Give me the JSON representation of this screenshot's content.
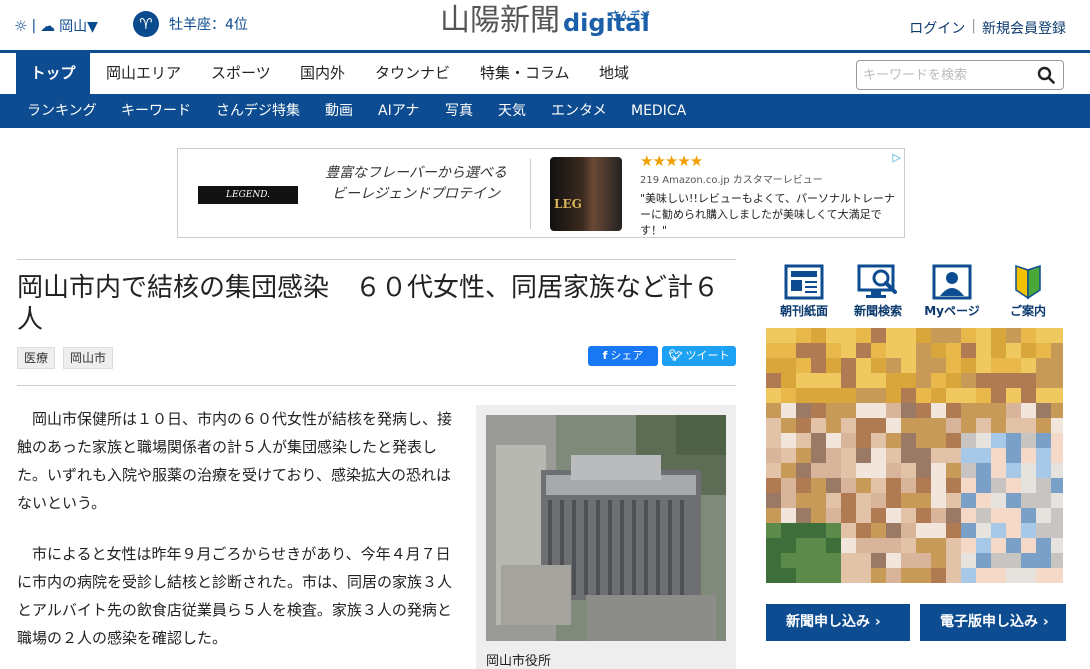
{
  "header": {
    "weather_city": "岡山▼",
    "horoscope": "牡羊座：4位",
    "logo_jp": "山陽新聞",
    "logo_digital": "digital",
    "logo_sub": "さんデジ",
    "login": "ログイン",
    "register": "新規会員登録"
  },
  "nav_main": {
    "items": [
      "トップ",
      "岡山エリア",
      "スポーツ",
      "国内外",
      "タウンナビ",
      "特集・コラム",
      "地域"
    ],
    "active_index": 0
  },
  "search": {
    "placeholder": "キーワードを検索"
  },
  "nav_sub": {
    "items": [
      "ランキング",
      "キーワード",
      "さんデジ特集",
      "動画",
      "AIアナ",
      "写真",
      "天気",
      "エンタメ",
      "MEDICA"
    ]
  },
  "ad": {
    "brand": "LEGEND.",
    "copy": "豊富なフレーバーから選べるビーレジェンドプロテイン",
    "product_label": "LEG",
    "stars": "★★★★★",
    "review_meta": "219 Amazon.co.jp カスタマーレビュー",
    "quote": "\"美味しい!!レビューもよくて、パーソナルトレーナーに勧められ購入しましたが美味しくて大満足です！\"",
    "rating": 4.5
  },
  "article": {
    "title": "岡山市内で結核の集団感染　６０代女性、同居家族など計６人",
    "tags": [
      "医療",
      "岡山市"
    ],
    "share_facebook": "シェア",
    "share_twitter": "ツイート",
    "paragraphs": [
      "岡山市保健所は１０日、市内の６０代女性が結核を発病し、接触のあった家族と職場関係者の計５人が集団感染したと発表した。いずれも入院や服薬の治療を受けており、感染拡大の恐れはないという。",
      "市によると女性は昨年９月ごろからせきがあり、今年４月７日に市内の病院を受診し結核と診断された。市は、同居の家族３人とアルバイト先の飲食店従業員ら５人を検査。家族３人の発病と職場の２人の感染を確認した。"
    ],
    "photo_caption": "岡山市役所"
  },
  "sidebar": {
    "icons": [
      "朝刊紙面",
      "新聞検索",
      "Myページ",
      "ご案内"
    ],
    "button_subscribe": "新聞申し込み ›",
    "button_digital": "電子版申し込み ›"
  },
  "colors": {
    "brand_blue": "#0d4c91",
    "facebook": "#1877f2",
    "twitter": "#1da1f2"
  }
}
